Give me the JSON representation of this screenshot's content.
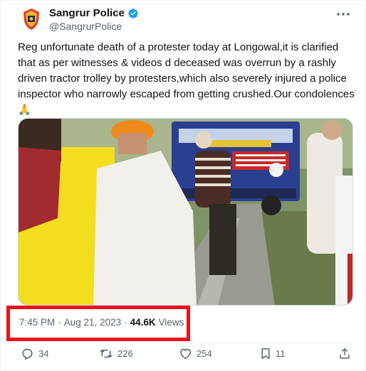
{
  "tweet": {
    "author": {
      "display_name": "Sangrur Police",
      "handle": "@SangrurPolice",
      "verified": true,
      "avatar_icon": "police-badge-icon"
    },
    "text": "Reg unfortunate death of a protester today at Longowal,it is clarified that as per witnesses & videos d deceased was overrun by a rashly driven tractor trolley by protesters,which also severely injured a police inspector who narrowly escaped from getting crushed.Our condolences ",
    "emoji": "🙏",
    "media": {
      "type": "video",
      "description_icon": "video-frame"
    },
    "meta": {
      "time": "7:45 PM",
      "separator": "·",
      "date": "Aug 21, 2023",
      "views_count": "44.6K",
      "views_label": "Views",
      "highlight_color": "#e5141b"
    },
    "actions": {
      "replies": "34",
      "reposts": "226",
      "likes": "254",
      "bookmarks": "11"
    }
  },
  "colors": {
    "text_primary": "#0f1419",
    "text_secondary": "#536471",
    "verified_blue": "#1d9bf0"
  }
}
